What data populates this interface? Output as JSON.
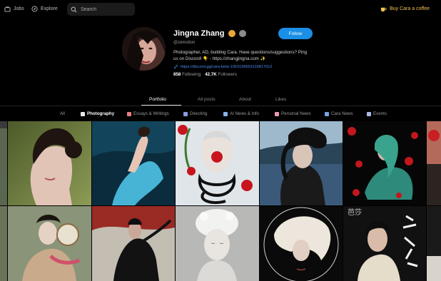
{
  "nav": {
    "jobs_label": "Jobs",
    "explore_label": "Explore",
    "search_placeholder": "Search",
    "coffee_label": "Buy Cara a coffee"
  },
  "profile": {
    "name": "Jingna Zhang",
    "handle": "@zemotion",
    "bio": "Photographer, AD, building Cara. Have questions/suggestions? Ping us on Discord! 👇 - https://zhangjingna.com ✨",
    "link": "https://discord.gg/cara-beta-1053156653115817012",
    "following_count": "858",
    "following_label": "Following",
    "followers_count": "42.7K",
    "followers_label": "Followers",
    "follow_button": "Follow"
  },
  "tabs": [
    "Portfolio",
    "All posts",
    "About",
    "Likes"
  ],
  "active_tab": "Portfolio",
  "categories": [
    {
      "label": "All"
    },
    {
      "label": "Photography",
      "icon": "camera-icon",
      "color": "#e9e9e9"
    },
    {
      "label": "Essays & Writings",
      "icon": "book-icon",
      "color": "#e87d7d"
    },
    {
      "label": "Directing",
      "icon": "clapper-icon",
      "color": "#8a9ae8"
    },
    {
      "label": "AI News & Info",
      "icon": "robot-icon",
      "color": "#8ab4e8"
    },
    {
      "label": "Personal News",
      "icon": "heart-icon",
      "color": "#e89ab0"
    },
    {
      "label": "Cara News",
      "icon": "cara-icon",
      "color": "#7aa0e8"
    },
    {
      "label": "Events",
      "icon": "calendar-icon",
      "color": "#a8b8e8"
    }
  ],
  "active_category": "Photography",
  "colors": {
    "accent": "#1a8fe6",
    "coffee": "#f2c14e",
    "link": "#4b8df0",
    "background": "#000000"
  }
}
